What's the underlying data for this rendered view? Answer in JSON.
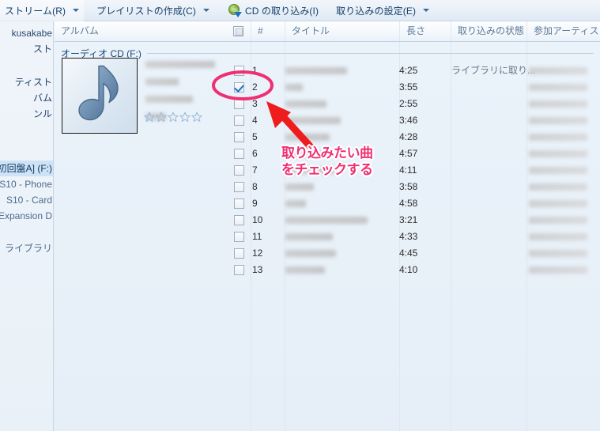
{
  "toolbar": {
    "items": [
      {
        "label": "ストリーム(R)",
        "caret": true,
        "icon": null
      },
      {
        "label": "プレイリストの作成(C)",
        "caret": true,
        "icon": null
      },
      {
        "label": "CD の取り込み(I)",
        "caret": false,
        "icon": "cd-rip-icon"
      },
      {
        "label": "取り込みの設定(E)",
        "caret": true,
        "icon": null
      }
    ]
  },
  "sidebar": {
    "items": [
      {
        "label": "kusakabe",
        "selected": false,
        "group": "head"
      },
      {
        "label": "スト",
        "selected": false,
        "group": ""
      },
      {
        "label": "",
        "selected": false,
        "group": "gap"
      },
      {
        "label": "ティスト",
        "selected": false,
        "group": ""
      },
      {
        "label": "バム",
        "selected": false,
        "group": ""
      },
      {
        "label": "ンル",
        "selected": false,
        "group": ""
      },
      {
        "label": "",
        "selected": false,
        "group": "gap"
      },
      {
        "label": "",
        "selected": false,
        "group": "gap"
      },
      {
        "label": "初回盤A] (F:)",
        "selected": true,
        "group": ""
      },
      {
        "label": "S10 - Phone",
        "selected": false,
        "group": ""
      },
      {
        "label": "S10 - Card",
        "selected": false,
        "group": ""
      },
      {
        "label": "e Expansion D",
        "selected": false,
        "group": ""
      },
      {
        "label": "",
        "selected": false,
        "group": "gap"
      },
      {
        "label": "ライブラリ",
        "selected": false,
        "group": ""
      }
    ]
  },
  "columns": {
    "album": "アルバム",
    "number": "#",
    "title": "タイトル",
    "length": "長さ",
    "rip_status": "取り込みの状態",
    "contributing_artist": "参加アーティスト"
  },
  "group": {
    "header": "オーディオ CD (F:)"
  },
  "album": {
    "art_icon": "music-note-icon",
    "rating_stars": 5,
    "rating_filled": 0
  },
  "tracks": [
    {
      "num": "1",
      "checked": false,
      "length": "4:25",
      "status": "ライブラリに取り...",
      "title_w": 78
    },
    {
      "num": "2",
      "checked": true,
      "length": "3:55",
      "status": "",
      "title_w": 22
    },
    {
      "num": "3",
      "checked": false,
      "length": "2:55",
      "status": "",
      "title_w": 52
    },
    {
      "num": "4",
      "checked": false,
      "length": "3:46",
      "status": "",
      "title_w": 70
    },
    {
      "num": "5",
      "checked": false,
      "length": "4:28",
      "status": "",
      "title_w": 56
    },
    {
      "num": "6",
      "checked": false,
      "length": "4:57",
      "status": "",
      "title_w": 44
    },
    {
      "num": "7",
      "checked": false,
      "length": "4:11",
      "status": "",
      "title_w": 62
    },
    {
      "num": "8",
      "checked": false,
      "length": "3:58",
      "status": "",
      "title_w": 36
    },
    {
      "num": "9",
      "checked": false,
      "length": "4:58",
      "status": "",
      "title_w": 26
    },
    {
      "num": "10",
      "checked": false,
      "length": "3:21",
      "status": "",
      "title_w": 104
    },
    {
      "num": "11",
      "checked": false,
      "length": "4:33",
      "status": "",
      "title_w": 60
    },
    {
      "num": "12",
      "checked": false,
      "length": "4:45",
      "status": "",
      "title_w": 64
    },
    {
      "num": "13",
      "checked": false,
      "length": "4:10",
      "status": "",
      "title_w": 50
    }
  ],
  "annotations": {
    "line1": "取り込みたい曲",
    "line2": "をチェックする",
    "ellipse_color": "#ef2f73",
    "arrow_color": "#ee1c1c",
    "text_color": "#ef2f73"
  }
}
